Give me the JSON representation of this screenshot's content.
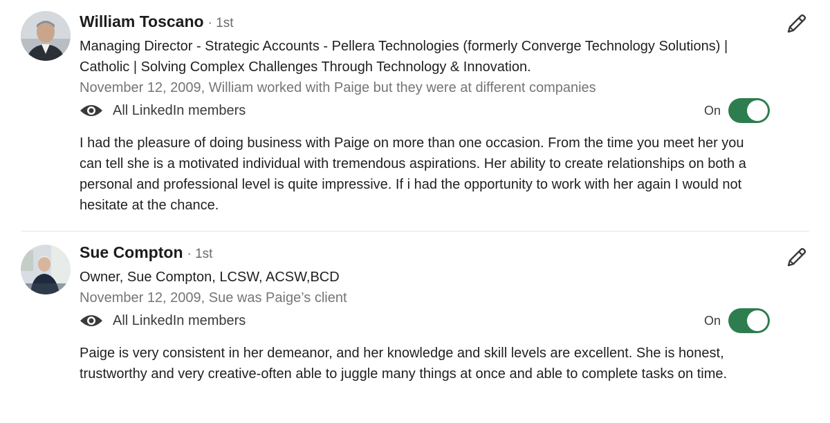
{
  "recommendations": [
    {
      "name": "William Toscano",
      "degree": "· 1st",
      "headline": "Managing Director - Strategic Accounts - Pellera Technologies (formerly Converge Technology Solutions) | Catholic | Solving Complex Challenges Through Technology & Innovation.",
      "date_relation": "November 12, 2009, William worked with Paige but they were at different companies",
      "visibility": "All LinkedIn members",
      "toggle_label": "On",
      "text": "I had the pleasure of doing business with Paige on more than one occasion. From the time you meet her you can tell she is a motivated individual with tremendous aspirations. Her ability to create relationships on both a personal and professional level is quite impressive. If i had the opportunity to work with her again I would not hesitate at the chance."
    },
    {
      "name": "Sue Compton",
      "degree": "· 1st",
      "headline": "Owner, Sue Compton, LCSW, ACSW,BCD",
      "date_relation": "November 12, 2009, Sue was Paige’s client",
      "visibility": "All LinkedIn members",
      "toggle_label": "On",
      "text": "Paige is very consistent in her demeanor, and her knowledge and skill levels are excellent. She is honest, trustworthy and very creative-often able to juggle many things at once and able to complete tasks on time."
    }
  ],
  "icons": {
    "edit": "pencil-icon",
    "visibility": "eye-icon"
  },
  "colors": {
    "toggle_on": "#2e7d4f",
    "secondary_text": "#757575"
  }
}
